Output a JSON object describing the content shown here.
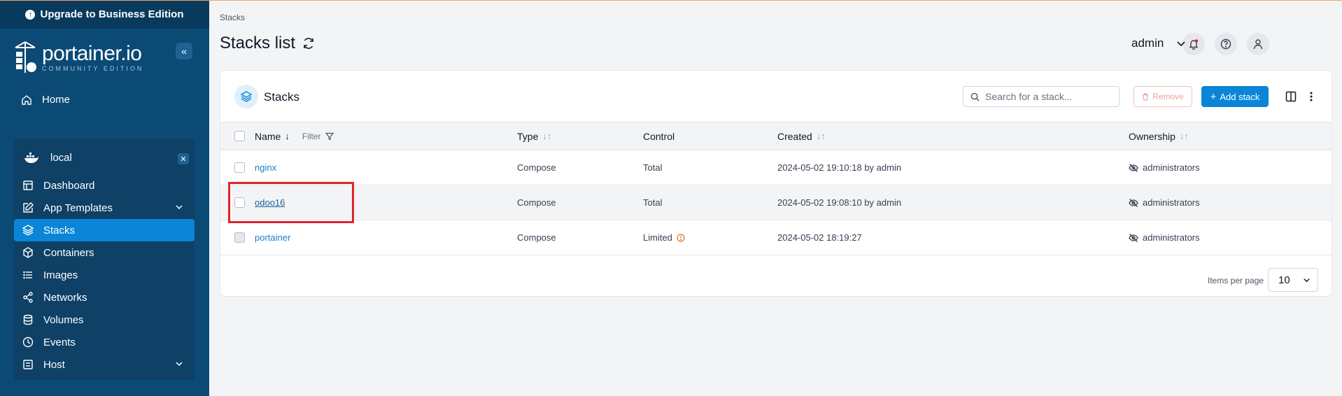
{
  "upgrade_banner": "Upgrade to Business Edition",
  "brand": {
    "name": "portainer.io",
    "edition": "COMMUNITY EDITION"
  },
  "sidebar": {
    "home": "Home",
    "environment": "local",
    "items": [
      {
        "label": "Dashboard",
        "icon": "dashboard-icon"
      },
      {
        "label": "App Templates",
        "icon": "edit-icon"
      },
      {
        "label": "Stacks",
        "icon": "layers-icon",
        "active": true
      },
      {
        "label": "Containers",
        "icon": "box-icon"
      },
      {
        "label": "Images",
        "icon": "list-icon"
      },
      {
        "label": "Networks",
        "icon": "share-icon"
      },
      {
        "label": "Volumes",
        "icon": "database-icon"
      },
      {
        "label": "Events",
        "icon": "clock-icon"
      },
      {
        "label": "Host",
        "icon": "host-icon"
      }
    ]
  },
  "header": {
    "breadcrumb": "Stacks",
    "title": "Stacks list",
    "user": "admin"
  },
  "card": {
    "title": "Stacks",
    "search_placeholder": "Search for a stack...",
    "remove_label": "Remove",
    "add_label": "Add stack"
  },
  "table": {
    "columns": {
      "name": "Name",
      "filter": "Filter",
      "type": "Type",
      "control": "Control",
      "created": "Created",
      "ownership": "Ownership"
    },
    "rows": [
      {
        "name": "nginx",
        "type": "Compose",
        "control": "Total",
        "created": "2024-05-02 19:10:18 by admin",
        "ownership": "administrators"
      },
      {
        "name": "odoo16",
        "type": "Compose",
        "control": "Total",
        "created": "2024-05-02 19:08:10 by admin",
        "ownership": "administrators"
      },
      {
        "name": "portainer",
        "type": "Compose",
        "control": "Limited",
        "created": "2024-05-02 18:19:27",
        "ownership": "administrators"
      }
    ]
  },
  "pagination": {
    "label": "Items per page",
    "value": "10"
  },
  "colors": {
    "sidebar": "#0b4a75",
    "accent": "#0a85d7",
    "highlight": "#e0242a"
  }
}
